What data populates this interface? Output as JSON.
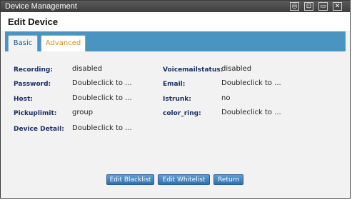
{
  "window": {
    "title": "Device Management"
  },
  "controls": [
    {
      "name": "settings-icon",
      "glyph": "◎"
    },
    {
      "name": "maximize-icon",
      "glyph": "⊡"
    },
    {
      "name": "restore-icon",
      "glyph": "▭"
    },
    {
      "name": "close-icon",
      "glyph": "✕"
    }
  ],
  "header": {
    "title": "Edit Device"
  },
  "tabs": {
    "basic": "Basic",
    "advanced": "Advanced"
  },
  "fields": {
    "recording": {
      "label": "Recording:",
      "value": "disabled"
    },
    "voicemailstatus": {
      "label": "Voicemailstatus:",
      "value": "disabled"
    },
    "password": {
      "label": "Password:",
      "value": "Doubleclick to ..."
    },
    "email": {
      "label": "Email:",
      "value": "Doubleclick to ..."
    },
    "host": {
      "label": "Host:",
      "value": "Doubleclick to ..."
    },
    "istrunk": {
      "label": "Istrunk:",
      "value": "no"
    },
    "pickuplimit": {
      "label": "Pickuplimit:",
      "value": "group"
    },
    "color_ring": {
      "label": "color_ring:",
      "value": "Doubleclick to ..."
    },
    "device_detail": {
      "label": "Device Detail:",
      "value": "Doubleclick to ..."
    }
  },
  "buttons": {
    "blacklist": "Edit Blacklist",
    "whitelist": "Edit Whitelist",
    "return": "Return"
  }
}
